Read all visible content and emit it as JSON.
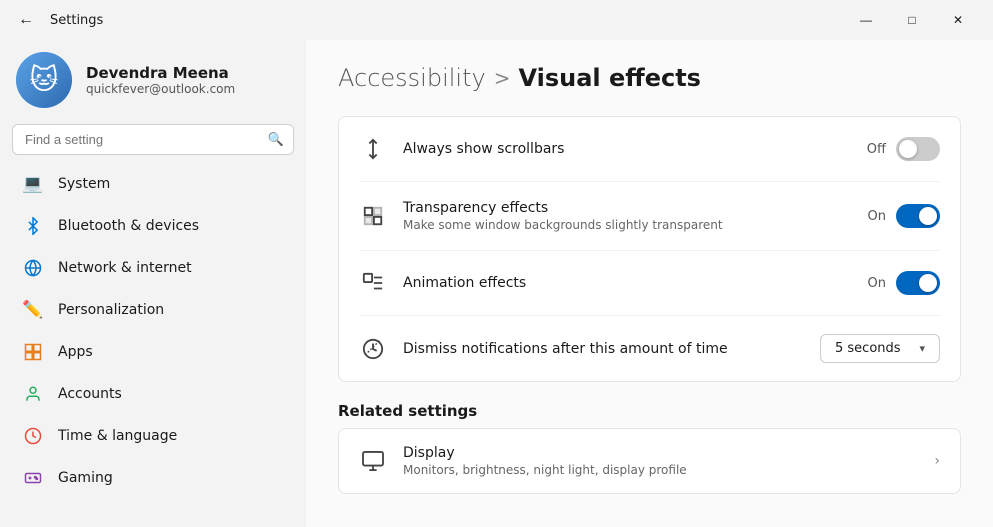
{
  "titleBar": {
    "title": "Settings",
    "backLabel": "←",
    "minimizeLabel": "—",
    "maximizeLabel": "□",
    "closeLabel": "✕"
  },
  "user": {
    "name": "Devendra Meena",
    "email": "quickfever@outlook.com",
    "avatarEmoji": "🐱"
  },
  "search": {
    "placeholder": "Find a setting",
    "iconLabel": "🔍"
  },
  "nav": {
    "items": [
      {
        "id": "system",
        "label": "System",
        "icon": "💻",
        "iconClass": "icon-system",
        "active": false
      },
      {
        "id": "bluetooth",
        "label": "Bluetooth & devices",
        "icon": "📶",
        "iconClass": "icon-bluetooth",
        "active": false
      },
      {
        "id": "network",
        "label": "Network & internet",
        "icon": "🌐",
        "iconClass": "icon-network",
        "active": false
      },
      {
        "id": "personalization",
        "label": "Personalization",
        "icon": "✏️",
        "iconClass": "icon-personalization",
        "active": false
      },
      {
        "id": "apps",
        "label": "Apps",
        "icon": "📦",
        "iconClass": "icon-apps",
        "active": false
      },
      {
        "id": "accounts",
        "label": "Accounts",
        "icon": "👤",
        "iconClass": "icon-accounts",
        "active": false
      },
      {
        "id": "time",
        "label": "Time & language",
        "icon": "🕐",
        "iconClass": "icon-time",
        "active": false
      },
      {
        "id": "gaming",
        "label": "Gaming",
        "icon": "🎮",
        "iconClass": "icon-gaming",
        "active": false
      }
    ]
  },
  "breadcrumb": {
    "parent": "Accessibility",
    "separator": ">",
    "current": "Visual effects"
  },
  "settings": [
    {
      "id": "scrollbars",
      "icon": "⇅",
      "label": "Always show scrollbars",
      "desc": "",
      "controlType": "toggle",
      "toggleState": "off",
      "toggleText": "Off"
    },
    {
      "id": "transparency",
      "icon": "⇄",
      "label": "Transparency effects",
      "desc": "Make some window backgrounds slightly transparent",
      "controlType": "toggle",
      "toggleState": "on",
      "toggleText": "On"
    },
    {
      "id": "animation",
      "icon": "⊟",
      "label": "Animation effects",
      "desc": "",
      "controlType": "toggle",
      "toggleState": "on",
      "toggleText": "On"
    },
    {
      "id": "dismiss",
      "icon": "✦",
      "label": "Dismiss notifications after this amount of time",
      "desc": "",
      "controlType": "dropdown",
      "dropdownValue": "5 seconds"
    }
  ],
  "relatedSettings": {
    "heading": "Related settings",
    "items": [
      {
        "id": "display",
        "icon": "🖥",
        "label": "Display",
        "desc": "Monitors, brightness, night light, display profile"
      }
    ]
  }
}
